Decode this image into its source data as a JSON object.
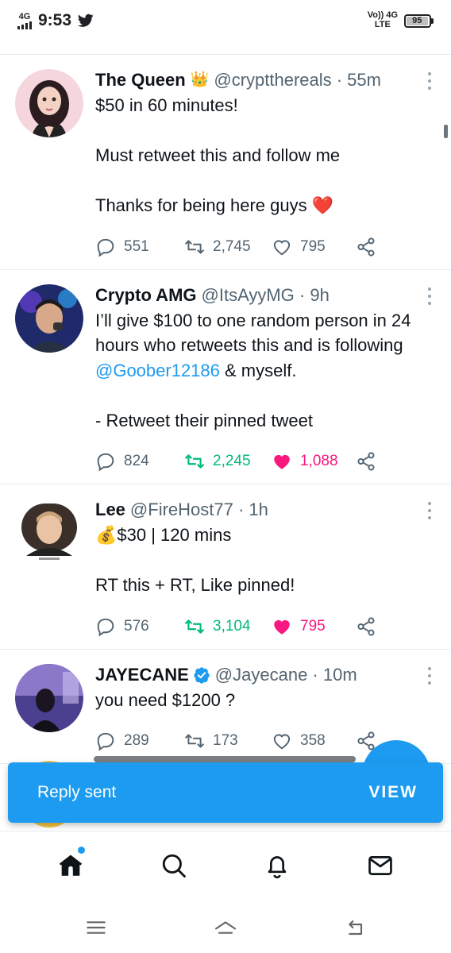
{
  "status_bar": {
    "network_left": "4G",
    "time": "9:53",
    "volte_top": "Vo)) 4G",
    "volte_bottom": "LTE",
    "battery": "95"
  },
  "tweets": [
    {
      "name": "The Queen",
      "badge": "👑",
      "handle": "@cryptthereals · 55m",
      "text_before": "$50 in 60 minutes!\n\nMust retweet this and follow me\n\nThanks for being here guys ",
      "emoji": "❤️",
      "mention": "",
      "text_after": "",
      "replies": "551",
      "retweets": "2,745",
      "likes": "795",
      "retweeted": false,
      "liked": false
    },
    {
      "name": "Crypto AMG",
      "badge": "",
      "handle": "@ItsAyyMG · 9h",
      "text_before": "I’ll give $100 to one random person in 24 hours who retweets this and is following ",
      "emoji": "",
      "mention": "@Goober12186",
      "text_after": " & myself.\n\n- Retweet their pinned tweet",
      "replies": "824",
      "retweets": "2,245",
      "likes": "1,088",
      "retweeted": true,
      "liked": true
    },
    {
      "name": "Lee",
      "badge": "",
      "handle": "@FireHost77 · 1h",
      "text_before": "",
      "emoji": "💰",
      "mention": "",
      "text_after": "$30 | 120 mins\n\nRT this + RT, Like pinned!",
      "replies": "576",
      "retweets": "3,104",
      "likes": "795",
      "retweeted": true,
      "liked": true
    },
    {
      "name": "JAYECANE",
      "badge": "verified",
      "handle": "@Jayecane · 10m",
      "text_before": "you need $1200 ?",
      "emoji": "",
      "mention": "",
      "text_after": "",
      "replies": "289",
      "retweets": "173",
      "likes": "358",
      "retweeted": false,
      "liked": false
    }
  ],
  "toast": {
    "message": "Reply sent",
    "action": "VIEW"
  },
  "bottom_nav": [
    "home-icon",
    "search-icon",
    "notifications-icon",
    "messages-icon"
  ],
  "system_nav": [
    "recents-icon",
    "home-button-icon",
    "back-icon"
  ],
  "colors": {
    "accent": "#1d9bf0",
    "retweet_green": "#00ba7c",
    "like_pink": "#f91880",
    "secondary_text": "#536471"
  }
}
